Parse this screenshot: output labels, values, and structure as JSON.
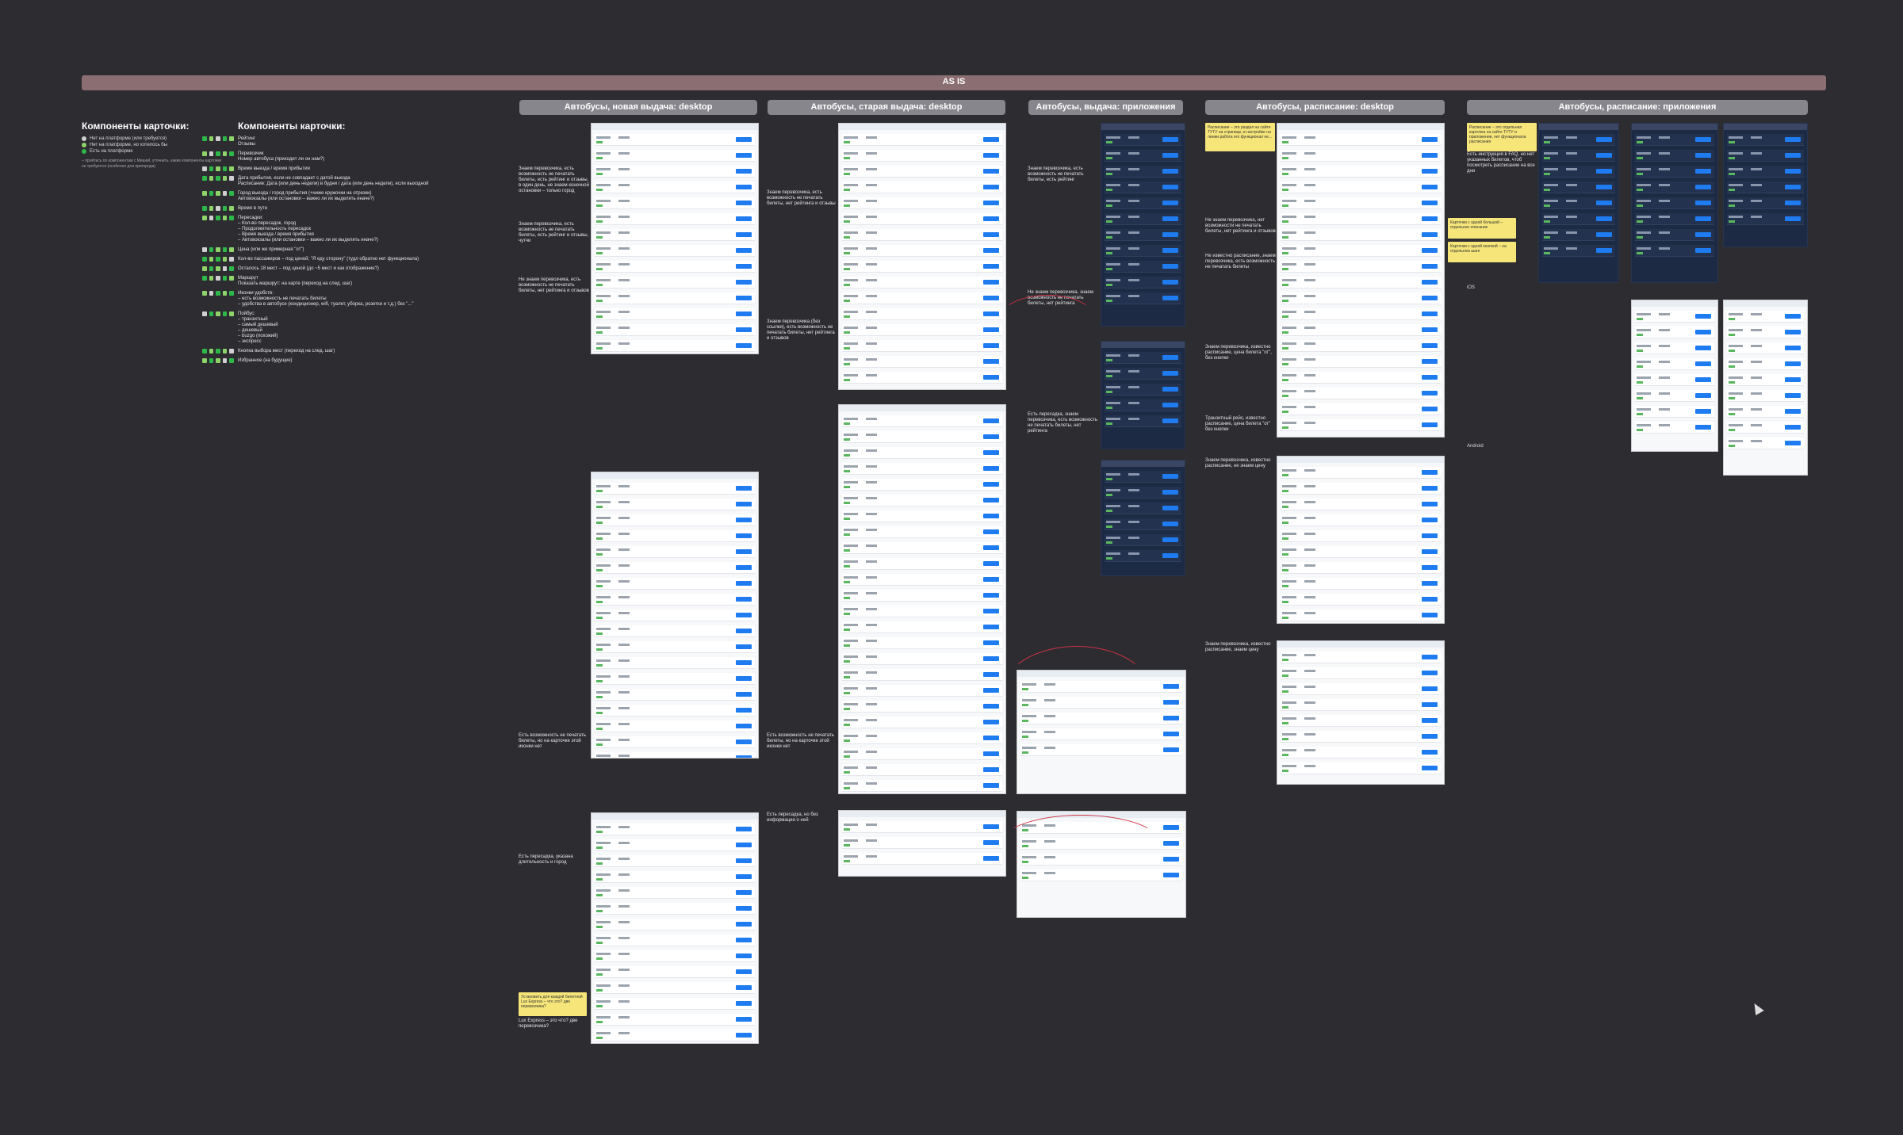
{
  "banner": {
    "title": "AS IS"
  },
  "sections": [
    {
      "label": "Автобусы, новая выдача: desktop"
    },
    {
      "label": "Автобусы, старая выдача: desktop"
    },
    {
      "label": "Автобусы, выдача: приложения"
    },
    {
      "label": "Автобусы, расписание: desktop"
    },
    {
      "label": "Автобусы, расписание: приложения"
    }
  ],
  "legend": {
    "title": "Компоненты карточки:",
    "items": [
      {
        "label": "Нет на платформе (или требуется)"
      },
      {
        "label": "Нет на платформе, но хотелось бы"
      },
      {
        "label": "Есть на платформе"
      }
    ],
    "note": "– пройтись по компонентам с Мишей, уточнить, какие компоненты карточки не требуются (особенно для пригорода)"
  },
  "components": {
    "title": "Компоненты карточки:",
    "items": [
      {
        "label": "Рейтинг\nОтзывы"
      },
      {
        "label": "Перевозчик\nНомер автобуса (приходит ли он нам?)"
      },
      {
        "label": "Время выезда / время прибытия"
      },
      {
        "label": "Дата прибытия, если не совпадает с датой выезда\nРасписание: Дата (или день недели) в будни / дата (или день недели), если выходной"
      },
      {
        "label": "Город выезда / город прибытия (+ниже кружочки на отрезки)\nАвтовокзалы (или остановки – важно ли их выделять иначе?)"
      },
      {
        "label": "Время в пути"
      },
      {
        "label": "Пересадки:\n– Кол-во пересадок, город\n– Продолжительность пересадок\n– Время выезда / время прибытия\n– Автовокзалы (или остановки – важно ли их выделять иначе?)"
      },
      {
        "label": "Цена (или же примерная \"от\")"
      },
      {
        "label": "Кол-во пассажиров – под ценой; \"Я еду сторону\" (тудл обратно нет функционала)"
      },
      {
        "label": "Осталось 18 мест – под ценой (до ~5 мест и как отображение?)"
      },
      {
        "label": "Маршрут\nПоказать маршрут: на карте (переход на след. шаг)"
      },
      {
        "label": "Иконки удобств:\n– есть возможность не печатать билеты\n– удобства в автобусе (кондиционер, wifi, туалет, уборка, розетки и т.д.) без \"...\""
      },
      {
        "label": "Пойбус:\n– транзитный\n– самый дешевый\n– дешевый\n– buzgo (похожий)\n– экспресс"
      },
      {
        "label": "Кнопка выбора мест (переход на след. шаг)"
      },
      {
        "label": "Избранное (на будущее)"
      }
    ]
  },
  "annotations": [
    {
      "text": "Знаем перевозчика, есть возможность не печатать билеты, есть рейтинг и отзывы, в один день, не знаем конечной остановки – только город"
    },
    {
      "text": "Знаем перевозчика, есть возможность не печатать билеты, есть рейтинг и отзывы, чутчи"
    },
    {
      "text": "Не знаем перевозчика, есть возможность не печатать билеты, нет рейтинга и отзывов"
    },
    {
      "text": "Есть возможность не печатать билеты, но на карточке этой иконки нет"
    },
    {
      "text": "Есть пересадка, указана длительность и город"
    },
    {
      "text": "Lux Express – это что? две перевозчика?"
    },
    {
      "text": "Знаем перевозчика, есть возможность не печатать билеты, нет рейтинга и отзывы"
    },
    {
      "text": "Знаем перевозчика (без ссылки), есть возможность не печатать билеты, нет рейтинга и отзывов"
    },
    {
      "text": "Есть возможность не печатать билеты, но на карточке этой иконки нет"
    },
    {
      "text": "Есть пересадка, но без информации о ней"
    },
    {
      "text": "Знаем перевозчика, есть возможность не печатать билеты, есть рейтинг"
    },
    {
      "text": "Не знаем перевозчика, знаем возможность не печатать билеты, нет рейтинга"
    },
    {
      "text": "Есть пересадка, знаем перевозчика, есть возможность не печатать билеты, нет рейтинга"
    },
    {
      "text": "Не знаем перевозчика, нет возможности не печатать билеты, нет рейтинга и отзывов"
    },
    {
      "text": "Не известно расписание, знаем перевозчика, есть возможность не печатать билеты"
    },
    {
      "text": "Знаем перевозчика, известно расписание, цена билета \"от\", без кнопки"
    },
    {
      "text": "Транзитный рейс, известно расписание, цена билета \"от\" без кнопки"
    },
    {
      "text": "Знаем перевозчика, известно расписание, не знаем цену"
    },
    {
      "text": "Знаем перевозчика, известно расписание, знаем цену"
    },
    {
      "text": "Есть инструкция в FAQ, но нет указанных билетов, чтоб посмотреть расписание на все дни"
    }
  ],
  "stickies": [
    {
      "text": "Установить для каждой билетной Lux Express – что это? две перевозчика?"
    },
    {
      "text": "Расписание – это раздел на сайте ТУТУ на странице, в настройке на линии работа его функционал не..."
    },
    {
      "text": "Карточки с одной большой – отдельное описание"
    },
    {
      "text": "Карточки с одной кнопкой – на отдельном шаге"
    },
    {
      "text": "Расписание – это отдельная карточка на сайте ТУТУ и приложении, нет функционала расписания"
    }
  ],
  "platforms": {
    "ios": "iOS",
    "android": "Android"
  }
}
